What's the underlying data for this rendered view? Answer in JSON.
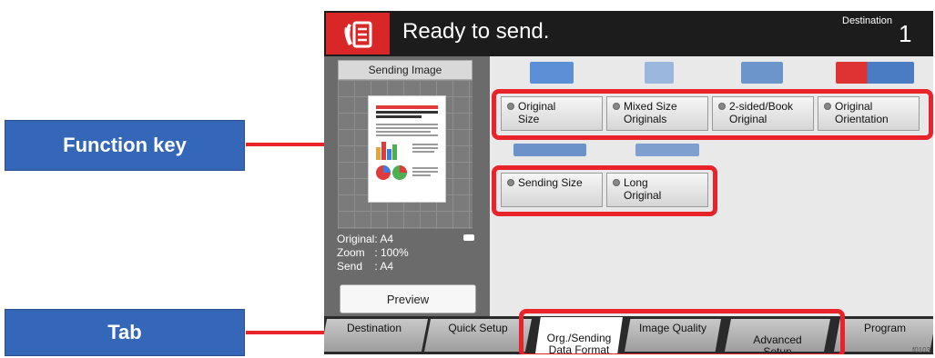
{
  "topbar": {
    "status_text": "Ready to send.",
    "destination_label": "Destination",
    "destination_count": "1",
    "icon": "send-document-icon"
  },
  "preview": {
    "header": "Sending Image",
    "info": [
      {
        "key": "Original",
        "value": ": A4"
      },
      {
        "key": "Zoom",
        "value": ": 100%"
      },
      {
        "key": "Send",
        "value": ": A4"
      }
    ],
    "preview_button": "Preview",
    "thumbnail_title": "Everything more faster about 99% and easier"
  },
  "functions": {
    "row1": [
      {
        "label": "Original\nSize"
      },
      {
        "label": "Mixed Size\nOriginals"
      },
      {
        "label": "2-sided/Book\nOriginal"
      },
      {
        "label": "Original\nOrientation"
      }
    ],
    "row2": [
      {
        "label": "Sending Size"
      },
      {
        "label": "Long\nOriginal"
      }
    ]
  },
  "tabs": [
    {
      "label": "Destination"
    },
    {
      "label": "Quick Setup"
    },
    {
      "label": "Org./Sending\nData Format",
      "active": true
    },
    {
      "label": "Image Quality"
    },
    {
      "label": "Advanced\nSetup"
    },
    {
      "label": "Program"
    }
  ],
  "callouts": {
    "function_key": "Function key",
    "tab": "Tab"
  },
  "caption": "f0103",
  "colors": {
    "callout_blue": "#3567b8",
    "highlight_red": "#e8232a",
    "icon_red": "#d92727",
    "topbar_black": "#1c1c1c"
  }
}
